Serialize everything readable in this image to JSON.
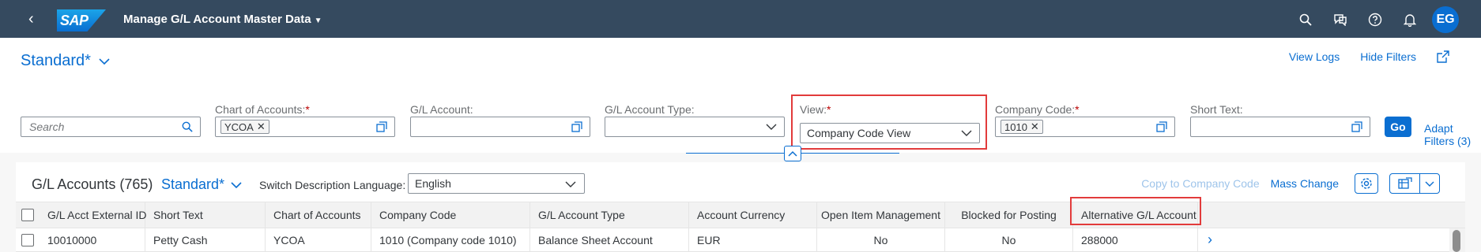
{
  "shell": {
    "logo": "SAP",
    "title": "Manage G/L Account Master Data",
    "avatar": "EG",
    "icons": [
      "search-icon",
      "feedback-icon",
      "help-icon",
      "notifications-icon"
    ]
  },
  "header": {
    "variant": "Standard*",
    "links": {
      "view_logs": "View Logs",
      "hide_filters": "Hide Filters"
    }
  },
  "filters": {
    "search_placeholder": "Search",
    "chart_of_accounts": {
      "label": "Chart of Accounts:",
      "required": "*",
      "token": "YCOA"
    },
    "gl_account": {
      "label": "G/L Account:",
      "value": ""
    },
    "gl_account_type": {
      "label": "G/L Account Type:",
      "value": ""
    },
    "view": {
      "label": "View:",
      "required": "*",
      "value": "Company Code View"
    },
    "company_code": {
      "label": "Company Code:",
      "required": "*",
      "token": "1010"
    },
    "short_text": {
      "label": "Short Text:",
      "value": ""
    },
    "go": "Go",
    "adapt": "Adapt Filters (3)"
  },
  "table": {
    "title": "G/L Accounts (765)",
    "variant": "Standard*",
    "switch_lang_label": "Switch Description Language:",
    "language": "English",
    "actions": {
      "copy": "Copy to Company Code",
      "mass_change": "Mass Change"
    },
    "columns": [
      "G/L Acct External ID",
      "Short Text",
      "Chart of Accounts",
      "Company Code",
      "G/L Account Type",
      "Account Currency",
      "Open Item Management",
      "Blocked for Posting",
      "Alternative G/L Account"
    ],
    "rows": [
      [
        "10010000",
        "Petty Cash",
        "YCOA",
        "1010 (Company code 1010)",
        "Balance Sheet Account",
        "EUR",
        "No",
        "No",
        "288000"
      ]
    ]
  },
  "colors": {
    "shell": "#354a5f",
    "accent": "#0a6ed1",
    "highlight": "#e23b3b"
  }
}
